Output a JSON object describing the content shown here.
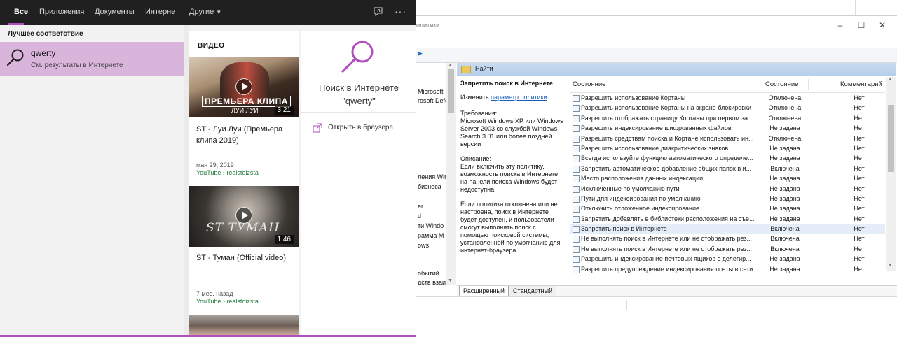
{
  "search": {
    "tabs": [
      {
        "label": "Все",
        "active": true
      },
      {
        "label": "Приложения"
      },
      {
        "label": "Документы"
      },
      {
        "label": "Интернет"
      },
      {
        "label": "Другие"
      }
    ],
    "more_glyph": "···",
    "best_match_label": "Лучшее соответствие",
    "best_match": {
      "title": "qwerty",
      "subtitle": "См. результаты в Интернете"
    },
    "video_section": {
      "header": "ВИДЕО",
      "videos": [
        {
          "thumb_text": "ПРЕМЬЕРА КЛИПА",
          "thumb_subtext": "ЛУИ ЛУИ",
          "duration": "3:21",
          "title": "ST - Луи Луи (Премьера клипа 2019)",
          "date": "мая 29, 2019",
          "source": "YouTube › realstoizsta"
        },
        {
          "thumb_text": "ST ТУМАН",
          "duration": "1:46",
          "title": "ST - Туман (Official video)",
          "date": "7 мес. назад",
          "source": "YouTube › realstoizsta"
        }
      ]
    },
    "web": {
      "line1": "Поиск в Интернете",
      "line2": "\"qwerty\"",
      "open_browser": "Открыть в браузере"
    },
    "accent_color": "#b24fbf"
  },
  "policy_window": {
    "title_fragment": "олитики",
    "find_label": "Найти",
    "tree_items": [
      "Microsoft",
      "rosoft Defe",
      "ления Wind",
      "бизнеса",
      "er",
      "d",
      "ти Windo",
      "рамма M",
      "ows",
      "обытий",
      "дств взаи"
    ],
    "description": {
      "title": "Запретить поиск в Интернете",
      "edit_prefix": "Изменить ",
      "edit_link": "параметр политики",
      "requirements_label": "Требования:",
      "requirements_text": "Microsoft Windows XP или Windows Server 2003 со службой Windows Search 3.01 или более поздней версии",
      "description_label": "Описание:",
      "description_text": "Если включить эту политику, возможность поиска в Интернете на панели поиска Windows будет недоступна.",
      "description_text2": "Если политика отключена или не настроена, поиск в Интернете будет доступен, и пользователи смогут выполнять поиск с помощью поисковой системы, установленной по умолчанию для интернет-браузера."
    },
    "columns": {
      "name": "Состояние",
      "state": "Состояние",
      "comment": "Комментарий"
    },
    "rows": [
      {
        "name": "Разрешить использование Кортаны",
        "state": "Отключена",
        "comment": "Нет"
      },
      {
        "name": "Разрешить использование Кортаны на экране блокировки",
        "state": "Отключена",
        "comment": "Нет"
      },
      {
        "name": "Разрешить отображать страницу Кортаны при первом за...",
        "state": "Отключена",
        "comment": "Нет"
      },
      {
        "name": "Разрешить индексирование шифрованных файлов",
        "state": "Не задана",
        "comment": "Нет"
      },
      {
        "name": "Разрешить средствам поиска и Кортане использовать ин...",
        "state": "Отключена",
        "comment": "Нет"
      },
      {
        "name": "Разрешить использование диакритических знаков",
        "state": "Не задана",
        "comment": "Нет"
      },
      {
        "name": "Всегда используйте функцию автоматического определе...",
        "state": "Не задана",
        "comment": "Нет"
      },
      {
        "name": "Запретить автоматическое добавление общих папок в и...",
        "state": "Включена",
        "comment": "Нет"
      },
      {
        "name": "Место расположения данных индексации",
        "state": "Не задана",
        "comment": "Нет"
      },
      {
        "name": "Исключенные по умолчанию пути",
        "state": "Не задана",
        "comment": "Нет"
      },
      {
        "name": "Пути для индексирования по умолчанию",
        "state": "Не задана",
        "comment": "Нет"
      },
      {
        "name": "Отключить отложенное индексирование",
        "state": "Не задана",
        "comment": "Нет"
      },
      {
        "name": "Запретить добавлять в библиотеки расположения на съе...",
        "state": "Не задана",
        "comment": "Нет"
      },
      {
        "name": "Запретить поиск в Интернете",
        "state": "Включена",
        "comment": "Нет",
        "selected": true
      },
      {
        "name": "Не выполнять поиск в Интернете или не отображать рез...",
        "state": "Включена",
        "comment": "Нет"
      },
      {
        "name": "Не выполнять поиск в Интернете или не отображать рез...",
        "state": "Включена",
        "comment": "Нет"
      },
      {
        "name": "Разрешить индексирование почтовых ящиков с делегир...",
        "state": "Не задана",
        "comment": "Нет"
      },
      {
        "name": "Разрешить предупреждение индексирования почты в сети",
        "state": "Не задана",
        "comment": "Нет"
      }
    ],
    "tabs": [
      "Расширенный",
      "Стандартный"
    ]
  }
}
